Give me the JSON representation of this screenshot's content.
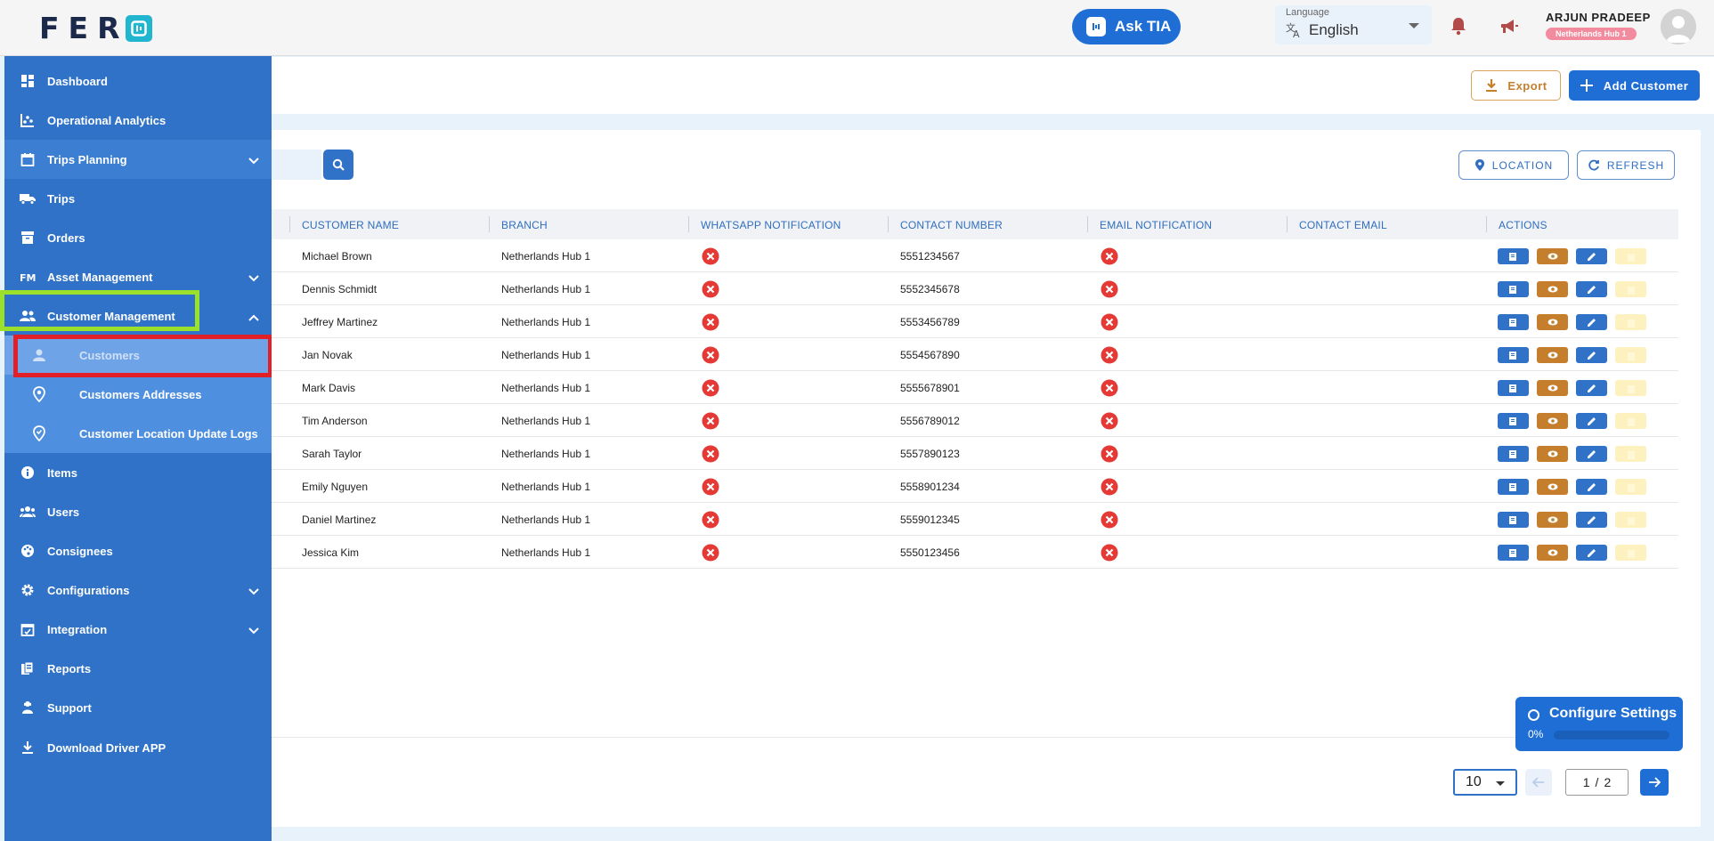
{
  "header": {
    "logo_text": "FER",
    "ask_label": "Ask TIA",
    "language_label": "Language",
    "language_value": "English",
    "user_name": "ARJUN PRADEEP",
    "user_badge": "Netherlands Hub 1"
  },
  "sidebar": {
    "items": [
      {
        "label": "Dashboard",
        "icon": "dashboard-icon"
      },
      {
        "label": "Operational Analytics",
        "icon": "analytics-icon"
      },
      {
        "label": "Trips Planning",
        "icon": "calendar-icon",
        "expandable": true
      },
      {
        "label": "Trips",
        "icon": "truck-icon"
      },
      {
        "label": "Orders",
        "icon": "orders-icon"
      },
      {
        "label": "Asset Management",
        "icon": "fm-icon",
        "expandable": true
      },
      {
        "label": "Customer Management",
        "icon": "people-icon",
        "expanded": true
      },
      {
        "label": "Customers",
        "icon": "person-icon",
        "active": true
      },
      {
        "label": "Customers Addresses",
        "icon": "location-pin-icon"
      },
      {
        "label": "Customer Location Update Logs",
        "icon": "location-check-icon"
      },
      {
        "label": "Items",
        "icon": "info-icon"
      },
      {
        "label": "Users",
        "icon": "users-icon"
      },
      {
        "label": "Consignees",
        "icon": "palette-icon"
      },
      {
        "label": "Configurations",
        "icon": "gear-icon",
        "expandable": true
      },
      {
        "label": "Integration",
        "icon": "integration-icon",
        "expandable": true
      },
      {
        "label": "Reports",
        "icon": "reports-icon"
      },
      {
        "label": "Support",
        "icon": "support-icon"
      },
      {
        "label": "Download Driver APP",
        "icon": "download-icon"
      }
    ]
  },
  "toolbar": {
    "export_label": "Export",
    "add_label": "Add Customer",
    "location_label": "LOCATION",
    "refresh_label": "REFRESH"
  },
  "table": {
    "columns": [
      "CUSTOMER NAME",
      "BRANCH",
      "WHATSAPP NOTIFICATION",
      "CONTACT NUMBER",
      "EMAIL NOTIFICATION",
      "CONTACT EMAIL",
      "ACTIONS"
    ],
    "rows": [
      {
        "name": "Michael Brown",
        "branch": "Netherlands Hub 1",
        "phone": "5551234567",
        "email": ""
      },
      {
        "name": "Dennis Schmidt",
        "branch": "Netherlands Hub 1",
        "phone": "5552345678",
        "email": ""
      },
      {
        "name": "Jeffrey Martinez",
        "branch": "Netherlands Hub 1",
        "phone": "5553456789",
        "email": ""
      },
      {
        "name": "Jan Novak",
        "branch": "Netherlands Hub 1",
        "phone": "5554567890",
        "email": ""
      },
      {
        "name": "Mark Davis",
        "branch": "Netherlands Hub 1",
        "phone": "5555678901",
        "email": ""
      },
      {
        "name": "Tim Anderson",
        "branch": "Netherlands Hub 1",
        "phone": "5556789012",
        "email": ""
      },
      {
        "name": "Sarah Taylor",
        "branch": "Netherlands Hub 1",
        "phone": "5557890123",
        "email": ""
      },
      {
        "name": "Emily Nguyen",
        "branch": "Netherlands Hub 1",
        "phone": "5558901234",
        "email": ""
      },
      {
        "name": "Daniel Martinez",
        "branch": "Netherlands Hub 1",
        "phone": "5559012345",
        "email": ""
      },
      {
        "name": "Jessica Kim",
        "branch": "Netherlands Hub 1",
        "phone": "5550123456",
        "email": ""
      }
    ]
  },
  "pagination": {
    "per_page": "10",
    "current": "1",
    "separator": "/",
    "total": "2"
  },
  "configure": {
    "title": "Configure Settings",
    "progress_label": "0%",
    "progress": 0
  },
  "colors": {
    "primary": "#1e6ed6",
    "sidebar": "#2f72c8",
    "export": "#c57f2c",
    "error": "#e53935"
  }
}
